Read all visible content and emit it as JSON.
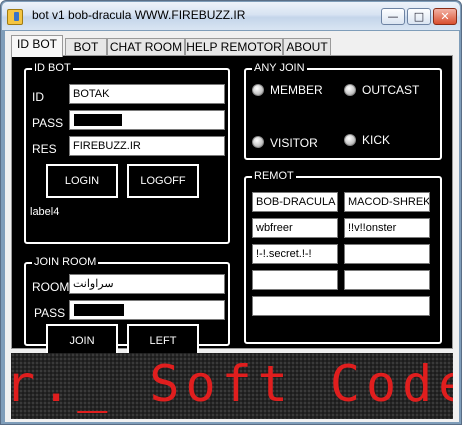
{
  "window": {
    "title": "bot v1 bob-dracula WWW.FIREBUZZ.IR",
    "icon": "app-icon",
    "controls": {
      "minimize": "—",
      "maximize": "□",
      "close": "✕"
    }
  },
  "tabs": [
    {
      "label": "ID BOT",
      "active": true
    },
    {
      "label": "BOT",
      "active": false
    },
    {
      "label": "CHAT ROOM",
      "active": false
    },
    {
      "label": "HELP REMOTOR",
      "active": false
    },
    {
      "label": "ABOUT",
      "active": false
    }
  ],
  "id_bot": {
    "legend": "ID BOT",
    "id_label": "ID",
    "id_value": "BOTAK",
    "pass_label": "PASS",
    "res_label": "RES",
    "res_value": "FIREBUZZ.IR",
    "login_label": "LOGIN",
    "logoff_label": "LOGOFF",
    "status_label": "label4"
  },
  "join_room": {
    "legend": "JOIN ROOM",
    "room_label": "ROOM",
    "room_value": "سراوانت",
    "pass_label": "PASS",
    "join_label": "JOIN",
    "left_label": "LEFT"
  },
  "any_join": {
    "legend": "ANY JOIN",
    "options": [
      "MEMBER",
      "OUTCAST",
      "VISITOR",
      "KICK"
    ]
  },
  "remot": {
    "legend": "REMOT",
    "fields": [
      "BOB-DRACULA",
      "MACOD-SHREK",
      "wbfreer",
      "!!v!!onster",
      "!-!.secret.!-!",
      "",
      "",
      "",
      ""
    ]
  },
  "marquee": {
    "text": "r._ Soft Coded by",
    "color": "#e01e1e"
  }
}
